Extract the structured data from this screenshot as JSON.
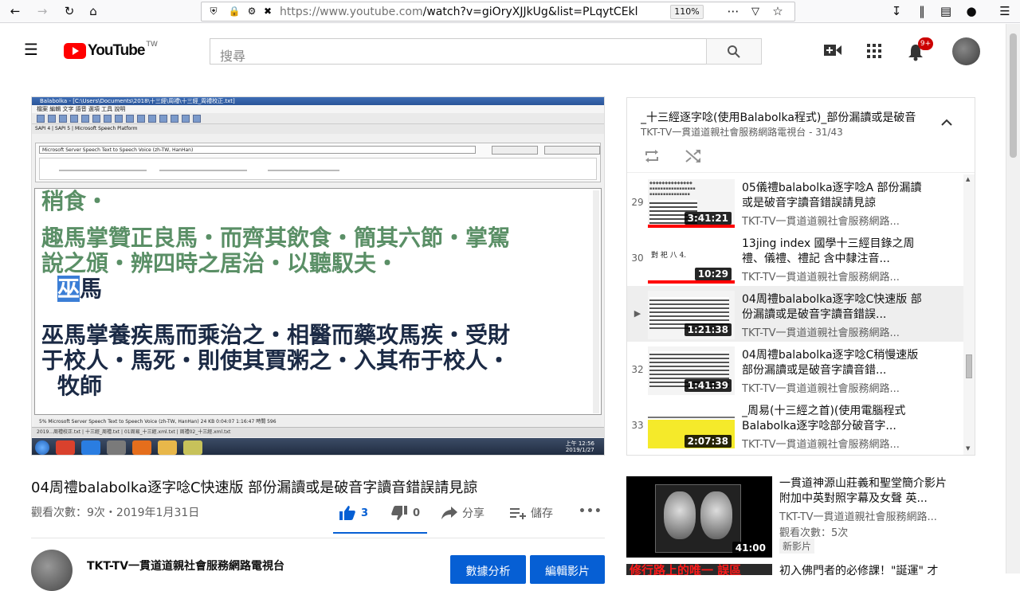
{
  "browser": {
    "url_host": "https://www.youtube.com",
    "url_rest": "/watch?v=giOryXJJkUg&list=PLqytCEklOad",
    "zoom": "110%"
  },
  "header": {
    "logo": "YouTube",
    "logo_region": "TW",
    "search_placeholder": "搜尋",
    "notifications": "9+"
  },
  "video": {
    "app_title": "Balabolka - [C:\\Users\\Documents\\2018\\十三經\\周禮\\十三經_周禮校正.txt]",
    "app_menu": "檔案  編輯  文字  語音  選項  工具  說明",
    "voice": "Microsoft Server Speech Text to Speech Voice (zh-TW, HanHan)",
    "tabs": "SAPI 4 | SAPI 5 | Microsoft Speech Platform",
    "line1": "稍食・",
    "line2": "趣馬掌贊正良馬・而齊其飲食・簡其六節・掌駕",
    "line3": "說之頒・辨四時之居治・以聽馭夫・",
    "line4a": "巫",
    "line4b": "馬",
    "line5": "巫馬掌養疾馬而乘治之・相醫而藥攻馬疾・受財",
    "line6": "于校人・馬死・則使其賈粥之・入其布于校人・",
    "line7": "牧師",
    "status": "5%     Microsoft Server Speech Text to Speech Voice (zh-TW, HanHan)      24 KB      0:04:07      1:16:47     時間 596",
    "files": "2019...周禮校正.txt | 十三經_周禮.txt | 01周易_十三經.xml.txt | 周禮02_十三經.xml.txt",
    "clock": "上午 12:56",
    "date": "2019/1/27"
  },
  "watch": {
    "title": "04周禮balabolka逐字唸C快速版 部份漏讀或是破音字讀音錯誤請見諒",
    "views": "觀看次數：9次・2019年1月31日",
    "likes": "3",
    "dislikes": "0",
    "share": "分享",
    "save": "儲存",
    "more": "•••",
    "channel": "TKT-TV一貫道道親社會服務網路電視台",
    "btn_analytics": "數據分析",
    "btn_edit": "編輯影片"
  },
  "playlist": {
    "title": "_十三經逐字唸(使用Balabolka程式)_部份漏讀或是破音",
    "subtitle": "TKT-TV一貫道道親社會服務網路電視台 - 31/43",
    "items": [
      {
        "index": "29",
        "title": "05儀禮balabolka逐字唸A 部份漏讀或是破音字讀音錯誤請見諒",
        "channel": "TKT-TV一貫道道親社會服務網路...",
        "duration": "3:41:21",
        "progress": 1.0
      },
      {
        "index": "30",
        "title": "13jing index 國學十三經目錄之周禮、儀禮、禮記 含中隸注音...",
        "channel": "TKT-TV一貫道道親社會服務網路...",
        "duration": "10:29",
        "progress": 1.0
      },
      {
        "index": "▶",
        "title": "04周禮balabolka逐字唸C快速版 部份漏讀或是破音字讀音錯誤...",
        "channel": "TKT-TV一貫道道親社會服務網路...",
        "duration": "1:21:38",
        "progress": 0.0
      },
      {
        "index": "32",
        "title": "04周禮balabolka逐字唸C稍慢速版 部份漏讀或是破音字讀音錯...",
        "channel": "TKT-TV一貫道道親社會服務網路...",
        "duration": "1:41:39",
        "progress": 0.0
      },
      {
        "index": "33",
        "title": "_周易(十三經之首)(使用電腦程式Balabolka逐字唸部分破音字...",
        "channel": "TKT-TV一貫道道親社會服務網路...",
        "duration": "2:07:38",
        "progress": 0.0
      }
    ]
  },
  "recommended": [
    {
      "title": "一貫道神源山莊義和聖堂簡介影片附加中英對照字幕及女聲 英...",
      "channel": "TKT-TV一貫道道親社會服務網路...",
      "views": "觀看次數：5次",
      "badge": "新影片",
      "duration": "41:00"
    },
    {
      "title": "初入佛門者的必修課！\"誕運\" 才",
      "thumb_text": "修行路上的唯一 誤區"
    }
  ]
}
